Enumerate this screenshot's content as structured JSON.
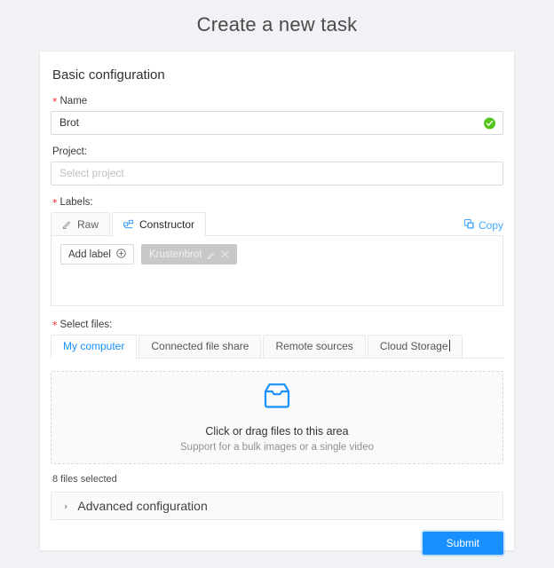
{
  "page": {
    "title": "Create a new task",
    "background_color": "#f0f2f5"
  },
  "card": {
    "section_title": "Basic configuration",
    "name": {
      "label": "Name",
      "required_mark": "*",
      "value": "Brot",
      "valid_icon": "check-circle-icon",
      "valid_color": "#52c41a"
    },
    "project": {
      "label": "Project:",
      "value": "",
      "placeholder": "Select project"
    },
    "labels": {
      "label": "Labels:",
      "required_mark": "*",
      "tabs": [
        {
          "label": "Raw",
          "icon": "pencil-icon",
          "active": false
        },
        {
          "label": "Constructor",
          "icon": "constructor-icon",
          "active": true
        }
      ],
      "copy": {
        "label": "Copy",
        "icon": "copy-icon",
        "color": "#40a9ff"
      },
      "add_label_button": {
        "label": "Add label",
        "icon": "plus-circle-icon"
      },
      "chips": [
        {
          "name": "Krustenbrot",
          "edit_icon": "pencil-icon",
          "close_icon": "close-icon",
          "color": "#c8c8c8"
        }
      ]
    },
    "select_files": {
      "label": "Select files:",
      "required_mark": "*",
      "tabs": [
        {
          "label": "My computer",
          "active": true
        },
        {
          "label": "Connected file share",
          "active": false
        },
        {
          "label": "Remote sources",
          "active": false
        },
        {
          "label": "Cloud Storage",
          "active": false,
          "has_caret": true
        }
      ],
      "dropzone": {
        "icon": "inbox-icon",
        "icon_color": "#1890ff",
        "primary_text": "Click or drag files to this area",
        "secondary_text": "Support for a bulk images or a single video"
      },
      "files_selected": "8 files selected"
    },
    "advanced": {
      "label": "Advanced configuration",
      "arrow": "›",
      "expanded": false
    },
    "submit": {
      "label": "Submit",
      "color": "#1890ff"
    }
  }
}
